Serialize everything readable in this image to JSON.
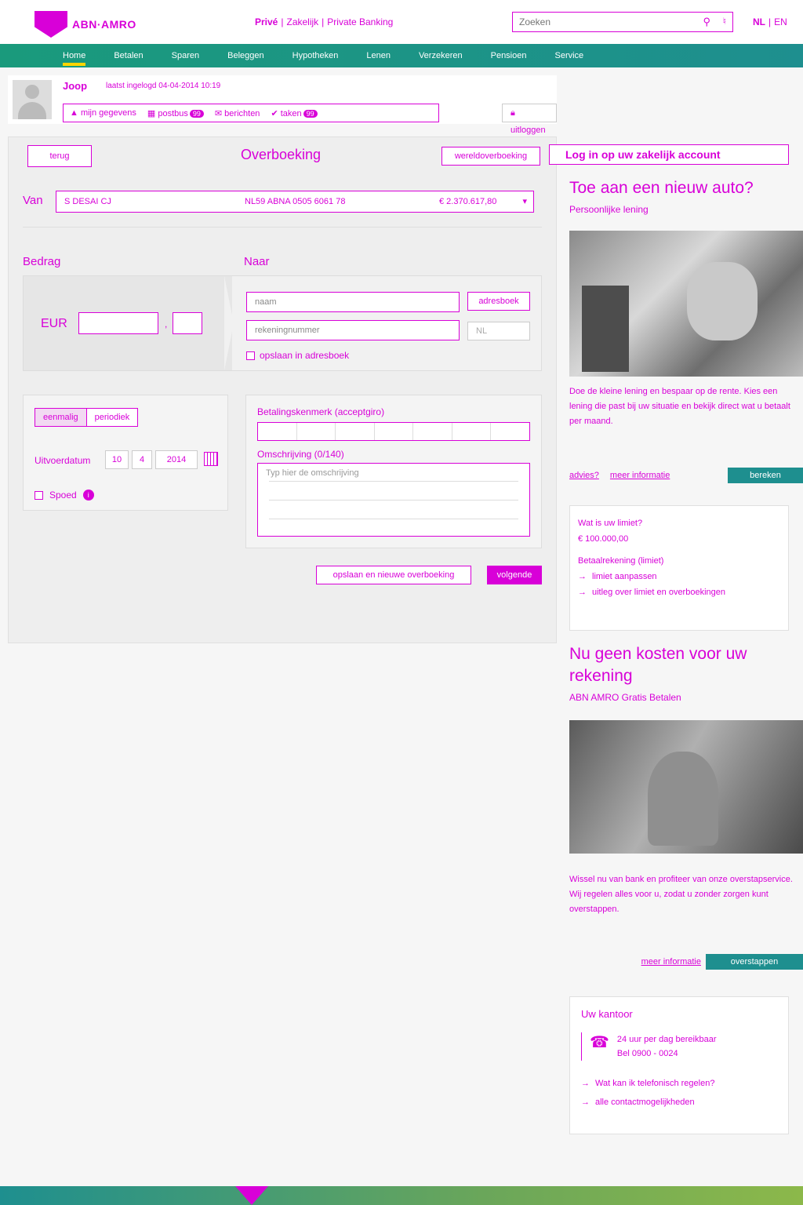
{
  "header": {
    "logo_text": "ABN·AMRO",
    "segments": [
      "Privé",
      "Zakelijk",
      "Private Banking"
    ],
    "search_placeholder": "Zoeken",
    "languages": [
      "NL",
      "EN"
    ]
  },
  "nav": {
    "items": [
      "Home",
      "Betalen",
      "Sparen",
      "Beleggen",
      "Hypotheken",
      "Lenen",
      "Verzekeren",
      "Pensioen",
      "Service"
    ]
  },
  "user": {
    "name": "Joop",
    "last_login": "laatst ingelogd 04-04-2014 10:19",
    "links": [
      "mijn gegevens",
      "postbus",
      "berichten",
      "taken"
    ],
    "postbus_count": "99",
    "taken_count": "99",
    "logout": "uitloggen"
  },
  "form": {
    "back": "terug",
    "title": "Overboeking",
    "intl_button": "wereldoverboeking",
    "from_label": "Van",
    "from_account": {
      "name": "S DESAI CJ",
      "iban": "NL59 ABNA 0505 6061 78",
      "balance": "€ 2.370.617,80"
    },
    "amount_label": "Bedrag",
    "to_label": "Naar",
    "currency": "EUR",
    "amount_int": "",
    "amount_dec": "",
    "name_placeholder": "naam",
    "account_placeholder": "rekeningnummer",
    "country_code": "NL",
    "address_book_button": "adresboek",
    "save_address": "opslaan in adresboek",
    "freq_options": [
      "eenmalig",
      "periodiek"
    ],
    "exec_label": "Uitvoerdatum",
    "exec_day": "10",
    "exec_month": "4",
    "exec_year": "2014",
    "urgent_label": "Spoed",
    "feature_label": "Betalingskenmerk (acceptgiro)",
    "description_label": "Omschrijving (0/140)",
    "description_placeholder": "Typ hier de omschrijving",
    "save_new_button": "opslaan en nieuwe overboeking",
    "next_button": "volgende"
  },
  "sidebar": {
    "promo_bar": "Log in op uw zakelijk account",
    "promo_heading": "Toe aan een nieuw auto?",
    "promo_sub": "Persoonlijke lening",
    "promo_text": "Doe de kleine lening en bespaar op de rente. Kies een lening die past bij uw situatie en bekijk direct wat u betaalt per maand.",
    "promo_links": [
      "advies?",
      "meer informatie"
    ],
    "promo_cta": "bereken",
    "limit_title": "Wat is uw limiet?",
    "limit_amount": "€ 100.000,00",
    "limit_note": "Betaalrekening (limiet)",
    "limit_links": [
      "limiet aanpassen",
      "uitleg over limiet en overboekingen"
    ],
    "promo2_heading": "Nu geen kosten voor uw rekening",
    "promo2_sub": "ABN AMRO Gratis Betalen",
    "promo2_text": "Wissel nu van bank en profiteer van onze overstapservice. Wij regelen alles voor u, zodat u zonder zorgen kunt overstappen.",
    "promo2_link": "meer informatie",
    "promo2_cta": "overstappen",
    "contact_title": "Uw kantoor",
    "contact_lines": [
      "24 uur per dag bereikbaar",
      "Bel 0900 - 0024"
    ],
    "contact_links": [
      "Wat kan ik telefonisch regelen?",
      "alle contactmogelijkheden"
    ]
  },
  "colors": {
    "accent": "#d800d8",
    "nav": "#1e8f8f",
    "highlight": "#ffd500"
  }
}
